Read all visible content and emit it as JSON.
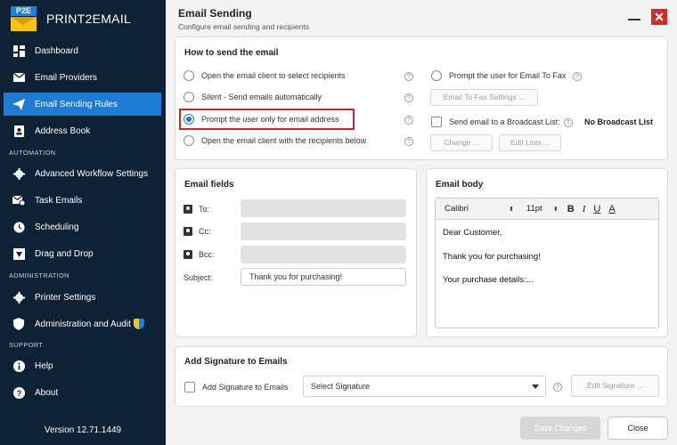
{
  "app": {
    "logo_badge": "P2E",
    "logo_text": "PRINT2EMAIL",
    "version": "Version 12.71.1449"
  },
  "sidebar": {
    "items": [
      {
        "label": "Dashboard",
        "icon": "dashboard-icon"
      },
      {
        "label": "Email Providers",
        "icon": "envelope-icon"
      },
      {
        "label": "Email Sending Rules",
        "icon": "send-icon",
        "active": true
      },
      {
        "label": "Address Book",
        "icon": "address-book-icon"
      }
    ],
    "automation_label": "AUTOMATION",
    "automation_items": [
      {
        "label": "Advanced Workflow Settings",
        "icon": "gear-icon"
      },
      {
        "label": "Task Emails",
        "icon": "task-email-icon"
      },
      {
        "label": "Scheduling",
        "icon": "clock-icon"
      },
      {
        "label": "Drag and Drop",
        "icon": "drag-drop-icon"
      }
    ],
    "administration_label": "ADMINISTRATION",
    "administration_items": [
      {
        "label": "Printer Settings",
        "icon": "printer-gear-icon"
      },
      {
        "label": "Administration and Audit",
        "icon": "shield-icon"
      }
    ],
    "support_label": "SUPPORT",
    "support_items": [
      {
        "label": "Help",
        "icon": "info-icon"
      },
      {
        "label": "About",
        "icon": "question-icon"
      }
    ]
  },
  "header": {
    "title": "Email Sending",
    "subtitle": "Configure email sending and recipients",
    "minimize": "",
    "close": "✕"
  },
  "how_to_send": {
    "title": "How to send the email",
    "options": [
      "Open the email client to select recipients",
      "Silent - Send emails automatically",
      "Prompt the user only for email address",
      "Open the email client with the recipients below"
    ],
    "selected_index": 2,
    "fax_option": "Prompt the user for Email To Fax",
    "fax_settings_button": "Email To Fax Settings ...",
    "broadcast_label": "Send email to a Broadcast List:",
    "broadcast_value": "No Broadcast List",
    "change_button": "Change ...",
    "edit_lists_button": "Edit Lists ..."
  },
  "email_fields": {
    "title": "Email fields",
    "to_label": "To:",
    "cc_label": "Cc:",
    "bcc_label": "Bcc:",
    "subject_label": "Subject:",
    "to_value": "",
    "cc_value": "",
    "bcc_value": "",
    "subject_value": "Thank you for purchasing!"
  },
  "email_body": {
    "title": "Email body",
    "font": "Calibri",
    "size": "11pt",
    "bold": "B",
    "italic": "I",
    "underline": "U",
    "color": "A",
    "lines": [
      "Dear Customer,",
      "Thank you for purchasing!",
      "Your purchase details:..."
    ]
  },
  "signature": {
    "title": "Add Signature to Emails",
    "checkbox_label": "Add Signature to Emails",
    "select_value": "Select Signature",
    "edit_button": "Edit Signature ..."
  },
  "footer": {
    "save_label": "Save Changes",
    "close_label": "Close"
  },
  "colors": {
    "sidebar_bg": "#0f2135",
    "accent": "#1f7ad1",
    "highlight_border": "#d2232a",
    "close_red": "#c9302c"
  }
}
